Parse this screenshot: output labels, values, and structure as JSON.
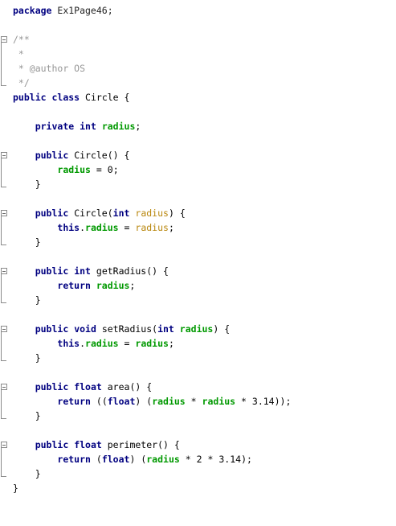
{
  "editor": {
    "lines": [
      "package Ex1Page46;",
      "",
      "/**",
      " *",
      " * @author OS",
      " */",
      "public class Circle {",
      "",
      "    private int radius;",
      "",
      "    public Circle() {",
      "        radius = 0;",
      "    }",
      "",
      "    public Circle(int radius) {",
      "        this.radius = radius;",
      "    }",
      "",
      "    public int getRadius() {",
      "        return radius;",
      "    }",
      "",
      "    public void setRadius(int radius) {",
      "        this.radius = radius;",
      "    }",
      "",
      "    public float area() {",
      "        return ((float) (radius * radius * 3.14));",
      "    }",
      "",
      "    public float perimeter() {",
      "        return (float) (radius * 2 * 3.14);",
      "    }",
      "}"
    ]
  }
}
